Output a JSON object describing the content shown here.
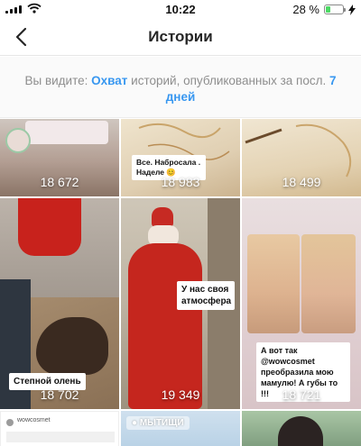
{
  "status_bar": {
    "time": "10:22",
    "battery": "28 %",
    "battery_level": 0.28
  },
  "header": {
    "title": "Истории",
    "back_icon": "chevron-left-icon"
  },
  "info": {
    "prefix": "Вы видите:",
    "metric": "Охват",
    "middle": "историй, опубликованных за посл.",
    "period": "7 дней"
  },
  "stories": [
    {
      "count": "18 672"
    },
    {
      "count": "18 983",
      "sticker": "Все. Набросала . Наделе 😊"
    },
    {
      "count": "18 499"
    },
    {
      "count": "18 702",
      "sticker": "Степной олень"
    },
    {
      "count": "19 349",
      "sticker": "У нас своя атмосфера"
    },
    {
      "count": "18 721",
      "sticker": "А вот так @wowcosmet преобразила мою мамулю! А губы то !!!"
    },
    {
      "username": "wowcosmet"
    },
    {
      "location": "МЫТИЩИ"
    },
    {}
  ]
}
